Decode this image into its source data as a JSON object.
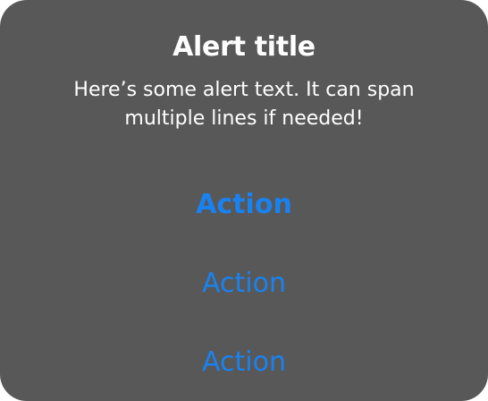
{
  "alert": {
    "title": "Alert title",
    "message": "Here’s some alert text. It can span multiple lines if needed!",
    "actions": [
      {
        "label": "Action",
        "style": "primary"
      },
      {
        "label": "Action",
        "style": "default"
      },
      {
        "label": "Action",
        "style": "default"
      }
    ]
  },
  "colors": {
    "background": "#585858",
    "text": "#ffffff",
    "action": "#1a82f0"
  }
}
